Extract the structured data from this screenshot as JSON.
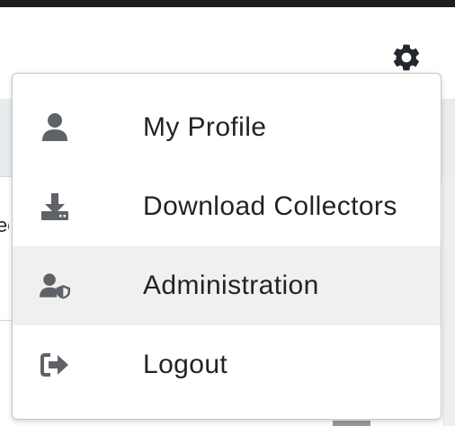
{
  "header": {
    "settings_icon": "gear-icon"
  },
  "background": {
    "clipped_text": "ec"
  },
  "menu": {
    "items": [
      {
        "label": "My Profile",
        "icon": "user-icon",
        "highlighted": false
      },
      {
        "label": "Download Collectors",
        "icon": "download-icon",
        "highlighted": false
      },
      {
        "label": "Administration",
        "icon": "user-shield-icon",
        "highlighted": true
      },
      {
        "label": "Logout",
        "icon": "logout-icon",
        "highlighted": false
      }
    ]
  },
  "colors": {
    "icon": "#5f6368",
    "gear": "#23282f",
    "text": "#1f2328",
    "highlight": "#f0f0f0"
  }
}
